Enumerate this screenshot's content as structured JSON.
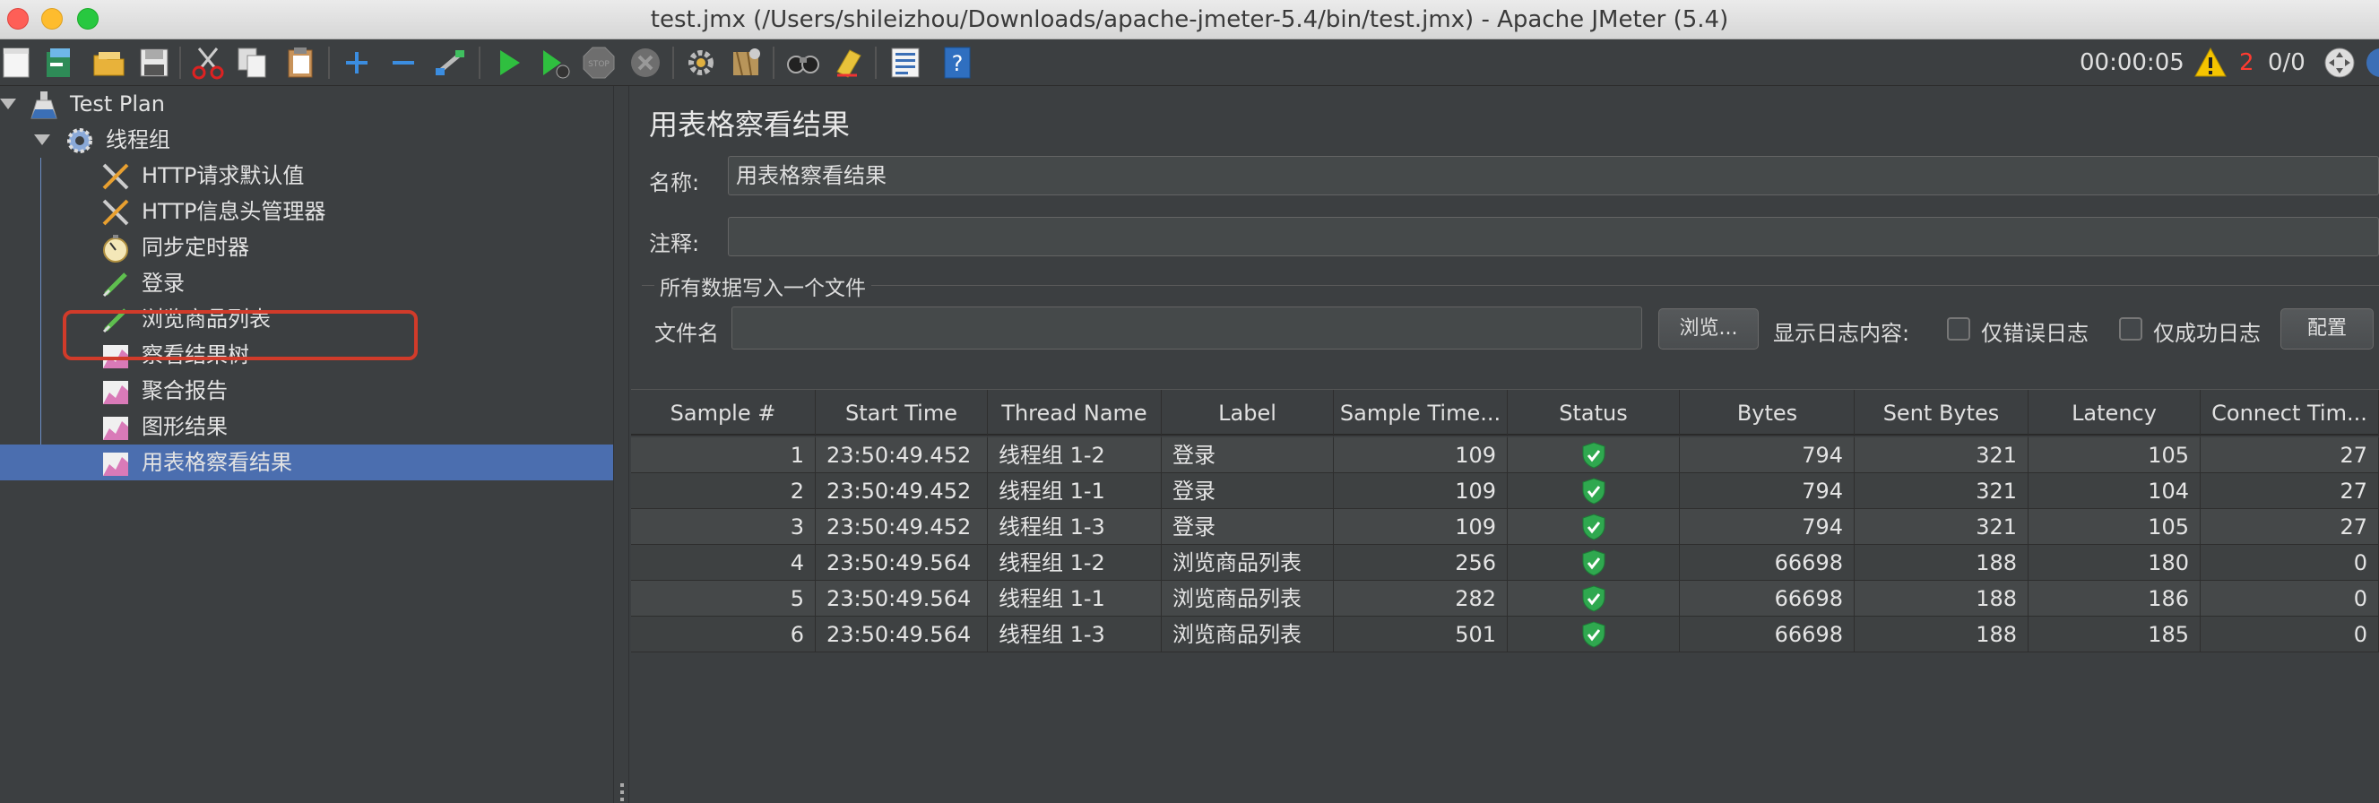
{
  "window": {
    "title": "test.jmx (/Users/shileizhou/Downloads/apache-jmeter-5.4/bin/test.jmx) - Apache JMeter (5.4)"
  },
  "toolbar": {
    "icons": [
      "new-file-icon",
      "templates-icon",
      "open-icon",
      "save-icon",
      "cut-icon",
      "copy-icon",
      "paste-icon",
      "expand-icon",
      "collapse-icon",
      "toggle-icon",
      "start-icon",
      "start-no-pause-icon",
      "stop-icon",
      "shutdown-icon",
      "clear-icon",
      "clear-all-icon",
      "search-icon",
      "reset-search-icon",
      "function-helper-icon",
      "help-icon"
    ],
    "elapsed_time": "00:00:05",
    "warning_count": "2",
    "active_threads": "0/0"
  },
  "tree": {
    "items": [
      {
        "label": "Test Plan",
        "icon": "flask-icon",
        "level": 0
      },
      {
        "label": "线程组",
        "icon": "gear-icon",
        "level": 1
      },
      {
        "label": "HTTP请求默认值",
        "icon": "wrench-icon",
        "level": 2
      },
      {
        "label": "HTTP信息头管理器",
        "icon": "wrench-icon",
        "level": 2
      },
      {
        "label": "同步定时器",
        "icon": "stopwatch-icon",
        "level": 2
      },
      {
        "label": "登录",
        "icon": "pipette-icon",
        "level": 2
      },
      {
        "label": "浏览商品列表",
        "icon": "pipette-icon",
        "level": 2
      },
      {
        "label": "察看结果树",
        "icon": "graph-icon",
        "level": 2
      },
      {
        "label": "聚合报告",
        "icon": "graph-icon",
        "level": 2
      },
      {
        "label": "图形结果",
        "icon": "graph-icon",
        "level": 2
      },
      {
        "label": "用表格察看结果",
        "icon": "graph-icon",
        "level": 2,
        "selected": true
      }
    ]
  },
  "panel": {
    "title": "用表格察看结果",
    "name_label": "名称:",
    "name_value": "用表格察看结果",
    "comment_label": "注释:",
    "comment_value": "",
    "file_group_title": "所有数据写入一个文件",
    "filename_label": "文件名",
    "filename_value": "",
    "browse_button": "浏览...",
    "log_content_label": "显示日志内容:",
    "errors_only_label": "仅错误日志",
    "success_only_label": "仅成功日志",
    "configure_button": "配置"
  },
  "table": {
    "columns": [
      "Sample #",
      "Start Time",
      "Thread Name",
      "Label",
      "Sample Time...",
      "Status",
      "Bytes",
      "Sent Bytes",
      "Latency",
      "Connect Tim..."
    ],
    "rows": [
      {
        "sample": "1",
        "start": "23:50:49.452",
        "thread": "线程组 1-2",
        "label": "登录",
        "time": "109",
        "status": "ok",
        "bytes": "794",
        "sent": "321",
        "latency": "105",
        "connect": "27"
      },
      {
        "sample": "2",
        "start": "23:50:49.452",
        "thread": "线程组 1-1",
        "label": "登录",
        "time": "109",
        "status": "ok",
        "bytes": "794",
        "sent": "321",
        "latency": "104",
        "connect": "27"
      },
      {
        "sample": "3",
        "start": "23:50:49.452",
        "thread": "线程组 1-3",
        "label": "登录",
        "time": "109",
        "status": "ok",
        "bytes": "794",
        "sent": "321",
        "latency": "105",
        "connect": "27"
      },
      {
        "sample": "4",
        "start": "23:50:49.564",
        "thread": "线程组 1-2",
        "label": "浏览商品列表",
        "time": "256",
        "status": "ok",
        "bytes": "66698",
        "sent": "188",
        "latency": "180",
        "connect": "0"
      },
      {
        "sample": "5",
        "start": "23:50:49.564",
        "thread": "线程组 1-1",
        "label": "浏览商品列表",
        "time": "282",
        "status": "ok",
        "bytes": "66698",
        "sent": "188",
        "latency": "186",
        "connect": "0"
      },
      {
        "sample": "6",
        "start": "23:50:49.564",
        "thread": "线程组 1-3",
        "label": "浏览商品列表",
        "time": "501",
        "status": "ok",
        "bytes": "66698",
        "sent": "188",
        "latency": "185",
        "connect": "0"
      }
    ]
  }
}
